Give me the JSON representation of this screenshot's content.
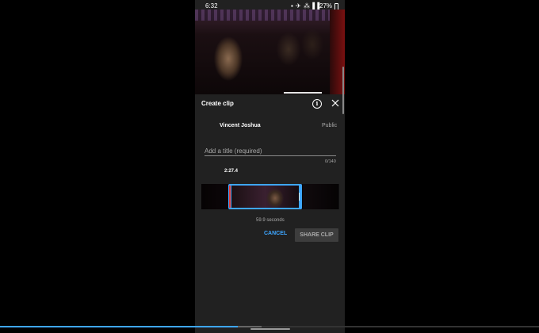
{
  "status_bar": {
    "time": "6:32",
    "icons": "▪ ✈ ⁂ ▌▌",
    "battery": "27%"
  },
  "sheet": {
    "title": "Create clip",
    "info_icon": "i",
    "channel_name": "Vincent Joshua",
    "visibility": "Public",
    "title_placeholder": "Add a title (required)",
    "title_value": "",
    "char_count": "0/140",
    "time_marker": "2:27.4",
    "clip_duration": "59.9 seconds",
    "cancel_label": "CANCEL",
    "share_label": "SHARE CLIP"
  },
  "colors": {
    "accent": "#3ea6ff",
    "sheet_bg": "#212121",
    "disabled_button": "#3d3d3d",
    "playhead": "#e53935"
  },
  "icons": [
    "info-icon",
    "close-icon",
    "battery-icon"
  ]
}
